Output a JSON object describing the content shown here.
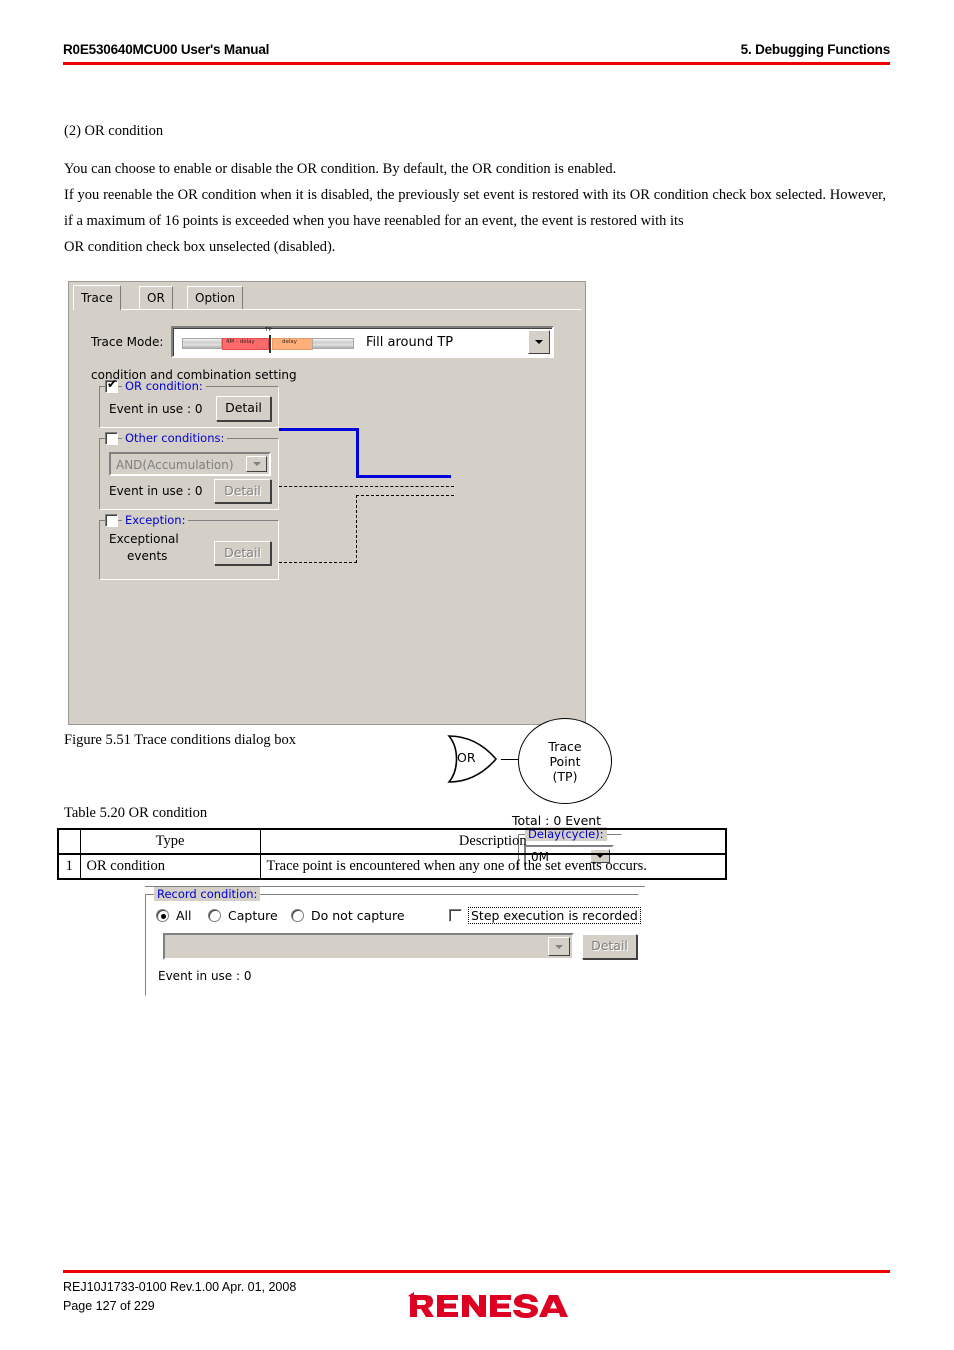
{
  "header": {
    "left": "R0E530640MCU00 User's Manual",
    "right": "5. Debugging Functions",
    "rule_color": "#ee0000"
  },
  "body": {
    "heading": "(2) OR condition",
    "paragraph1": "You can choose to enable or disable the OR condition. By default, the OR condition is enabled.",
    "paragraph2a": "If you reenable the OR condition when it is disabled, the previously set event is restored with its OR condition check box selected. However, if a maximum of 16 points is exceeded when you have reenabled for an event, the event is restored with its",
    "paragraph2b": "OR condition check box unselected (disabled)."
  },
  "dialog": {
    "tabs": [
      {
        "label": "Trace",
        "selected": true
      },
      {
        "label": "OR",
        "selected": false
      },
      {
        "label": "Option",
        "selected": false
      }
    ],
    "trace_mode": {
      "label": "Trace Mode:",
      "value": "Fill around TP",
      "graphic": {
        "tp_label": "TP",
        "segment_left": "4M - delay",
        "segment_right": "delay",
        "color_left": "#ff6b6b",
        "color_right": "#ffb07a"
      }
    },
    "condition_setting_label": "condition and combination setting",
    "or_condition": {
      "title": "OR condition:",
      "checked": true,
      "event_in_use": "Event in use :  0",
      "detail_label": "Detail",
      "detail_enabled": true,
      "wire_color": "#0000dd"
    },
    "other_conditions": {
      "title": "Other conditions:",
      "checked": false,
      "combo_value": "AND(Accumulation)",
      "event_in_use": "Event in use : 0",
      "detail_label": "Detail",
      "detail_enabled": false
    },
    "exception": {
      "title": "Exception:",
      "checked": false,
      "text_line1": "Exceptional",
      "text_line2": "events",
      "detail_label": "Detail",
      "detail_enabled": false
    },
    "or_gate_label": "OR",
    "trace_point": {
      "line1": "Trace",
      "line2": "Point",
      "line3": "(TP)"
    },
    "total_events": "Total :  0   Event",
    "delay": {
      "title": "Delay(cycle):",
      "value": "0M"
    },
    "record_condition": {
      "title": "Record condition:",
      "radios": [
        {
          "label": "All",
          "selected": true
        },
        {
          "label": "Capture",
          "selected": false
        },
        {
          "label": "Do not capture",
          "selected": false
        }
      ],
      "step_checkbox": {
        "label": "Step execution is recorded",
        "checked": false
      },
      "combo_value": "",
      "detail_label": "Detail",
      "detail_enabled": false,
      "event_in_use": "Event in use : 0"
    }
  },
  "figure_caption": "Figure 5.51 Trace conditions dialog box",
  "table_caption": "Table 5.20 OR condition",
  "table": {
    "headers": [
      "",
      "Type",
      "Description"
    ],
    "rows": [
      [
        "1",
        "OR condition",
        "Trace point is encountered when any one of the set events occurs."
      ]
    ]
  },
  "footer": {
    "line1": "REJ10J1733-0100    Rev.1.00    Apr. 01, 2008",
    "line2": "Page 127 of 229",
    "logo_text": "RENESAS",
    "logo_color": "#dd0022"
  }
}
